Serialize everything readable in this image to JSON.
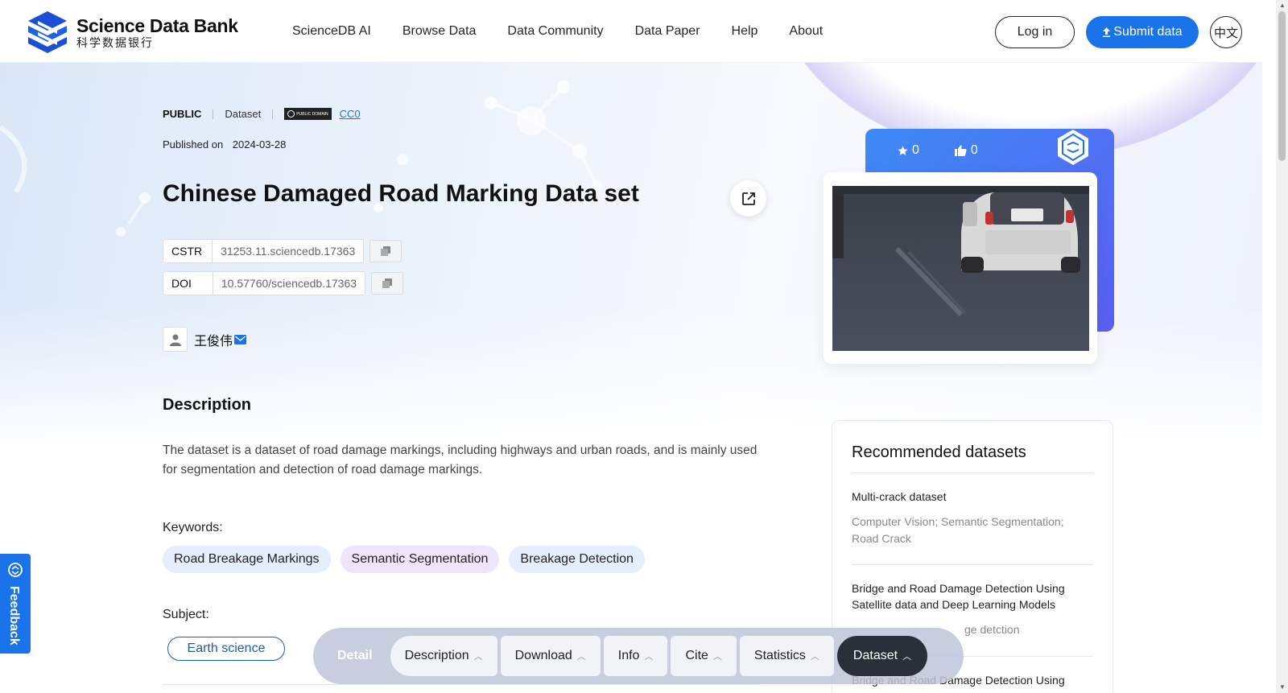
{
  "header": {
    "logo_en": "Science Data Bank",
    "logo_cn": "科学数据银行",
    "nav": [
      "ScienceDB AI",
      "Browse Data",
      "Data Community",
      "Data Paper",
      "Help",
      "About"
    ],
    "login_label": "Log in",
    "submit_label": "Submit data",
    "lang_label": "中文"
  },
  "dataset": {
    "access": "PUBLIC",
    "type": "Dataset",
    "license_badge": "PUBLIC DOMAIN",
    "license": "CC0",
    "published_label": "Published on",
    "published_date": "2024-03-28",
    "title": "Chinese Damaged Road Marking Data set",
    "cstr_label": "CSTR",
    "cstr_value": "31253.11.sciencedb.17363",
    "doi_label": "DOI",
    "doi_value": "10.57760/sciencedb.17363",
    "author": "王俊伟",
    "stars": "0",
    "likes": "0"
  },
  "description": {
    "heading": "Description",
    "text": "The dataset is a dataset of road damage markings, including highways and urban roads, and is mainly used for segmentation and detection of road damage markings.",
    "keywords_label": "Keywords:",
    "keywords": [
      "Road Breakage Markings",
      "Semantic Segmentation",
      "Breakage Detection"
    ],
    "subject_label": "Subject:",
    "subject": "Earth science"
  },
  "recommended": {
    "title": "Recommended datasets",
    "items": [
      {
        "title": "Multi-crack dataset",
        "keywords": "Computer Vision; Semantic Segmentation; Road Crack"
      },
      {
        "title": "Bridge and Road Damage Detection Using Satellite data and Deep Learning Models",
        "keywords": "ge detction"
      },
      {
        "title": "Bridge and Road Damage Detection Using",
        "keywords": ""
      }
    ]
  },
  "feedback_label": "Feedback",
  "bottom_bar": {
    "detail_label": "Detail",
    "tabs": [
      "Description",
      "Download",
      "Info",
      "Cite",
      "Statistics",
      "Dataset"
    ]
  },
  "colors": {
    "accent": "#1a73e8",
    "card_gradient_start": "#3d8bf5",
    "card_gradient_end": "#5b5ef2"
  }
}
